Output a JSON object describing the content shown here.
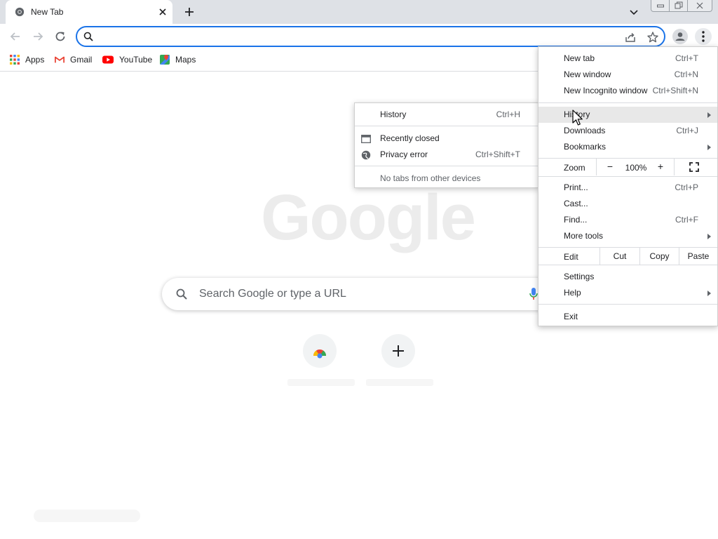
{
  "tab": {
    "title": "New Tab"
  },
  "toolbar": {
    "omnibox_value": ""
  },
  "bookmarks": [
    {
      "label": "Apps",
      "icon": "apps-grid-icon"
    },
    {
      "label": "Gmail",
      "icon": "gmail-icon"
    },
    {
      "label": "YouTube",
      "icon": "youtube-icon"
    },
    {
      "label": "Maps",
      "icon": "maps-icon"
    }
  ],
  "ntp": {
    "logo": "Google",
    "search_placeholder": "Search Google or type a URL"
  },
  "menu": {
    "new_tab": {
      "label": "New tab",
      "shortcut": "Ctrl+T"
    },
    "new_window": {
      "label": "New window",
      "shortcut": "Ctrl+N"
    },
    "new_incognito": {
      "label": "New Incognito window",
      "shortcut": "Ctrl+Shift+N"
    },
    "history": {
      "label": "History"
    },
    "downloads": {
      "label": "Downloads",
      "shortcut": "Ctrl+J"
    },
    "bookmarks": {
      "label": "Bookmarks"
    },
    "zoom": {
      "label": "Zoom",
      "minus": "−",
      "value": "100%",
      "plus": "+"
    },
    "print": {
      "label": "Print...",
      "shortcut": "Ctrl+P"
    },
    "cast": {
      "label": "Cast..."
    },
    "find": {
      "label": "Find...",
      "shortcut": "Ctrl+F"
    },
    "more_tools": {
      "label": "More tools"
    },
    "edit": {
      "label": "Edit",
      "cut": "Cut",
      "copy": "Copy",
      "paste": "Paste"
    },
    "settings": {
      "label": "Settings"
    },
    "help": {
      "label": "Help"
    },
    "exit": {
      "label": "Exit"
    }
  },
  "history_submenu": {
    "history": {
      "label": "History",
      "shortcut": "Ctrl+H"
    },
    "recently_closed": {
      "label": "Recently closed"
    },
    "privacy_error": {
      "label": "Privacy error",
      "shortcut": "Ctrl+Shift+T"
    },
    "no_tabs": {
      "label": "No tabs from other devices"
    }
  },
  "colors": {
    "accent": "#1a73e8",
    "menu_highlight": "#e8e8e8",
    "tabstrip": "#dee1e6"
  }
}
